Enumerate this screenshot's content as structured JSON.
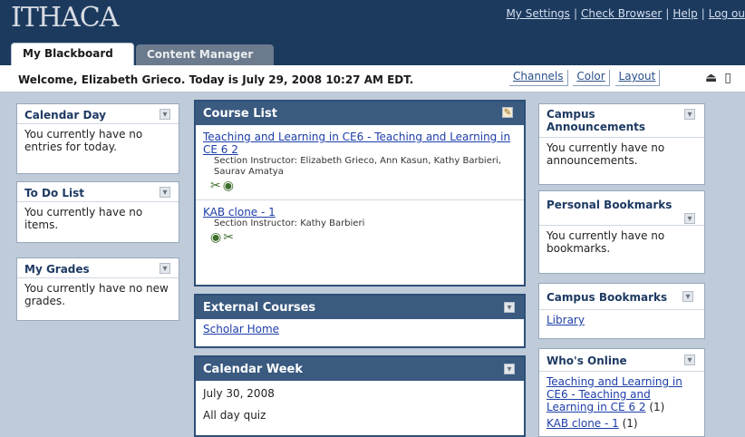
{
  "header": {
    "logo": "ITHACA",
    "links": [
      "My Settings",
      "Check Browser",
      "Help",
      "Log ou"
    ],
    "separator": "|"
  },
  "tabs": [
    {
      "label": "My Blackboard",
      "active": true
    },
    {
      "label": "Content Manager",
      "active": false
    }
  ],
  "welcome": "Welcome, Elizabeth Grieco. Today is July 29, 2008 10:27 AM EDT.",
  "toolbar_links": [
    "Channels",
    "Color",
    "Layout"
  ],
  "left_modules": [
    {
      "title": "Calendar Day",
      "body": "You currently have no entries for today."
    },
    {
      "title": "To Do List",
      "body": "You currently have no items."
    },
    {
      "title": "My Grades",
      "body": "You currently have no new grades."
    }
  ],
  "course_list": {
    "title": "Course List",
    "courses": [
      {
        "name": "Teaching and Learning in CE6 - Teaching and Learning in CE 6 2",
        "instructors": "Section Instructor: Elizabeth Grieco, Ann Kasun, Kathy Barbieri, Saurav Amatya"
      },
      {
        "name": "KAB clone - 1",
        "instructors": "Section Instructor: Kathy Barbieri"
      }
    ]
  },
  "external_courses": {
    "title": "External Courses",
    "link": "Scholar Home"
  },
  "calendar_week": {
    "title": "Calendar Week",
    "date": "July 30, 2008",
    "event": "All day quiz"
  },
  "right_modules": {
    "announcements": {
      "title": "Campus Announcements",
      "body": "You currently have no announcements."
    },
    "personal_bookmarks": {
      "title": "Personal Bookmarks",
      "body": "You currently have no bookmarks."
    },
    "campus_bookmarks": {
      "title": "Campus Bookmarks",
      "link": "Library"
    },
    "whos_online": {
      "title": "Who's Online",
      "entries": [
        {
          "name": "Teaching and Learning in CE6 - Teaching and Learning in CE 6 2",
          "count": "(1)"
        },
        {
          "name": "KAB clone - 1",
          "count": "(1)"
        }
      ]
    }
  },
  "icons": {
    "module_control": "minimize-icon",
    "course_list_edit": "pencil-icon",
    "toolbar": [
      "notification-icon",
      "page-icon"
    ]
  }
}
